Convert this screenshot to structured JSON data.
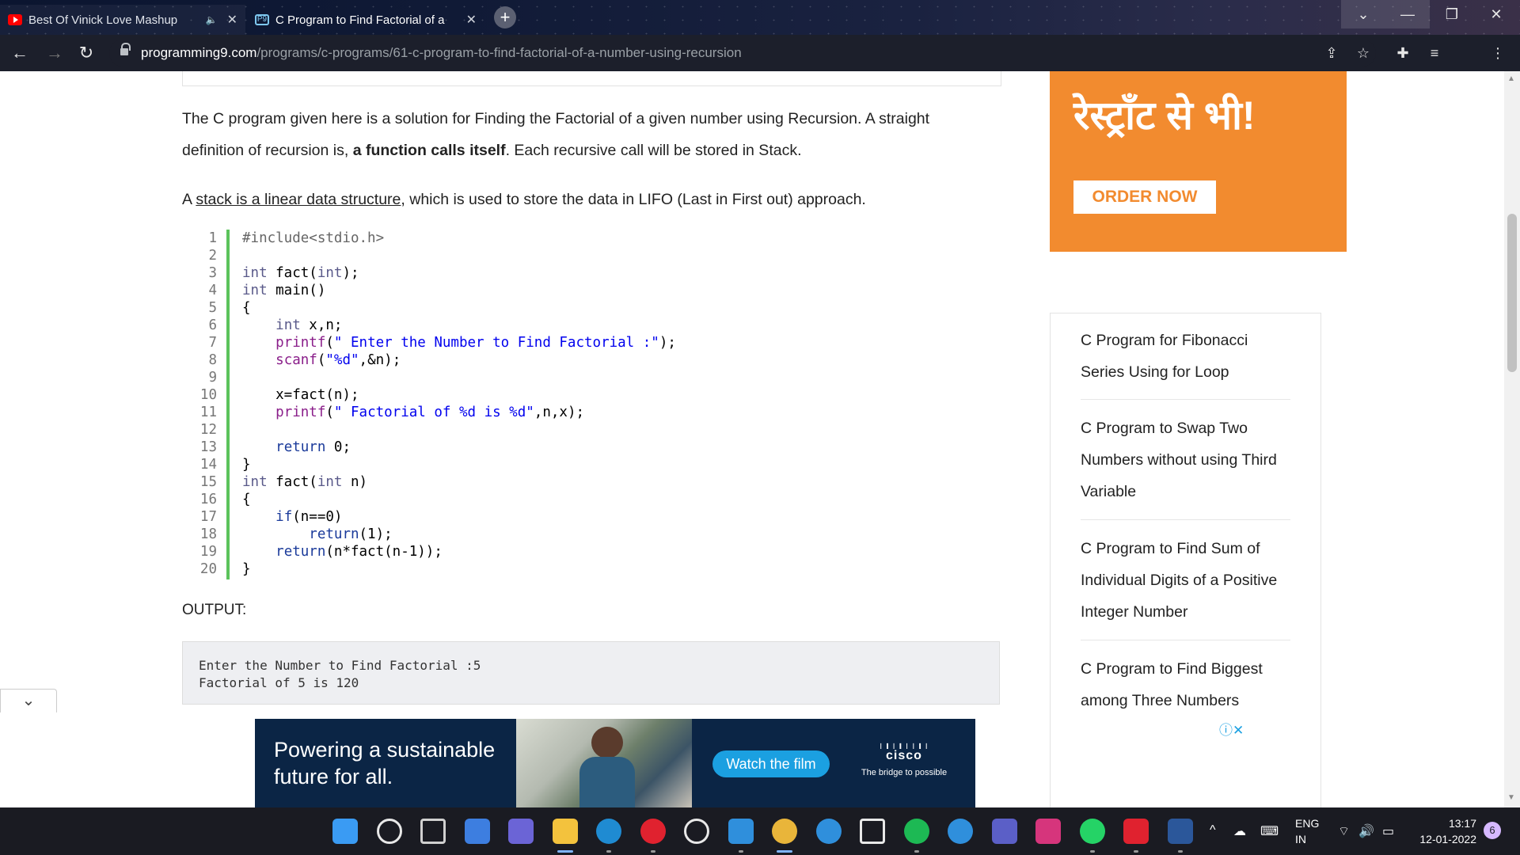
{
  "browser": {
    "tabs": [
      {
        "title": "Best Of Vinick Love Mashup",
        "icon": "youtube-icon",
        "audio": "speaker-icon"
      },
      {
        "title": "C Program to Find Factorial of a",
        "icon": "p9-favicon"
      }
    ],
    "url_host": "programming9.com",
    "url_path": "/programs/c-programs/61-c-program-to-find-factorial-of-a-number-using-recursion"
  },
  "article": {
    "p1_a": "The C program given here is a solution for Finding the Factorial of a given number using Recursion. A straight definition of recursion is, ",
    "p1_b": "a function calls itself",
    "p1_c": ". Each recursive call will be stored in Stack.",
    "p2_a": "A ",
    "p2_link": "stack is a linear data structure",
    "p2_c": ", which is used to store the data in LIFO (Last in First out) approach.",
    "code_lines": [
      "#include<stdio.h>",
      "",
      "int fact(int);",
      "int main()",
      "{",
      "    int x,n;",
      "    printf(\" Enter the Number to Find Factorial :\");",
      "    scanf(\"%d\",&n);",
      "",
      "    x=fact(n);",
      "    printf(\" Factorial of %d is %d\",n,x);",
      "",
      "    return 0;",
      "}",
      "int fact(int n)",
      "{",
      "    if(n==0)",
      "        return(1);",
      "    return(n*fact(n-1));",
      "}"
    ],
    "output_label": "OUTPUT:",
    "output_lines": [
      "Enter the Number to Find Factorial :5",
      "Factorial of 5 is 120"
    ]
  },
  "side_ad": {
    "headline": "रेस्ट्राँट से भी!",
    "button": "ORDER NOW",
    "color": "#f28b2f"
  },
  "related": [
    "C Program for Fibonacci Series Using for Loop",
    "C Program to Swap Two Numbers without using Third Variable",
    "C Program to Find Sum of Individual Digits of a Positive Integer Number",
    "C Program to Find Biggest among Three Numbers"
  ],
  "banner_ad": {
    "headline": "Powering a sustainable future for all.",
    "cta": "Watch the film",
    "brand": "cisco",
    "tagline": "The bridge to possible"
  },
  "taskbar": {
    "apps": [
      "windows-start-icon",
      "search-icon",
      "task-view-icon",
      "widgets-icon",
      "teams-chat-icon",
      "file-explorer-icon",
      "edge-icon",
      "opera-icon",
      "github-icon",
      "vscode-icon",
      "chrome-icon",
      "help-icon",
      "store-icon",
      "spotify-icon",
      "cortana-icon",
      "teams-icon",
      "instagram-icon",
      "whatsapp-icon",
      "acrobat-icon",
      "word-icon"
    ],
    "lang_top": "ENG",
    "lang_bottom": "IN",
    "time": "13:17",
    "date": "12-01-2022",
    "notifications": "6"
  }
}
